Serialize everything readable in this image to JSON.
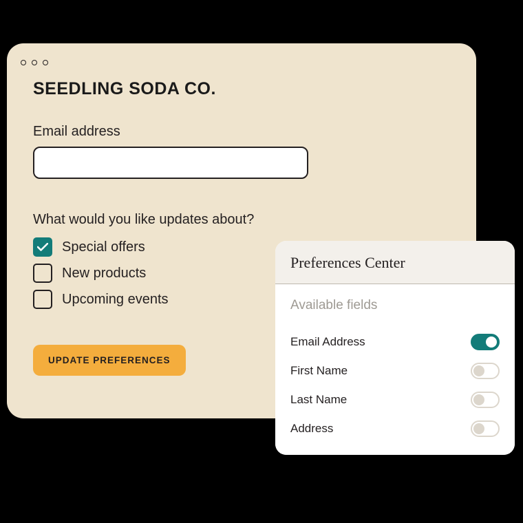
{
  "browser": {
    "brand": "SEEDLING SODA CO.",
    "email_label": "Email address",
    "email_value": "",
    "checkbox_heading": "What would you like updates about?",
    "checkboxes": [
      {
        "label": "Special offers",
        "checked": true
      },
      {
        "label": "New products",
        "checked": false
      },
      {
        "label": "Upcoming events",
        "checked": false
      }
    ],
    "update_button": "UPDATE PREFERENCES"
  },
  "pref_center": {
    "title": "Preferences Center",
    "available_label": "Available fields",
    "fields": [
      {
        "label": "Email Address",
        "on": true
      },
      {
        "label": "First Name",
        "on": false
      },
      {
        "label": "Last Name",
        "on": false
      },
      {
        "label": "Address",
        "on": false
      }
    ]
  },
  "colors": {
    "window_bg": "#efe4ce",
    "accent_teal": "#137c79",
    "button_orange": "#f4ad3d",
    "text_dark": "#231f20"
  }
}
